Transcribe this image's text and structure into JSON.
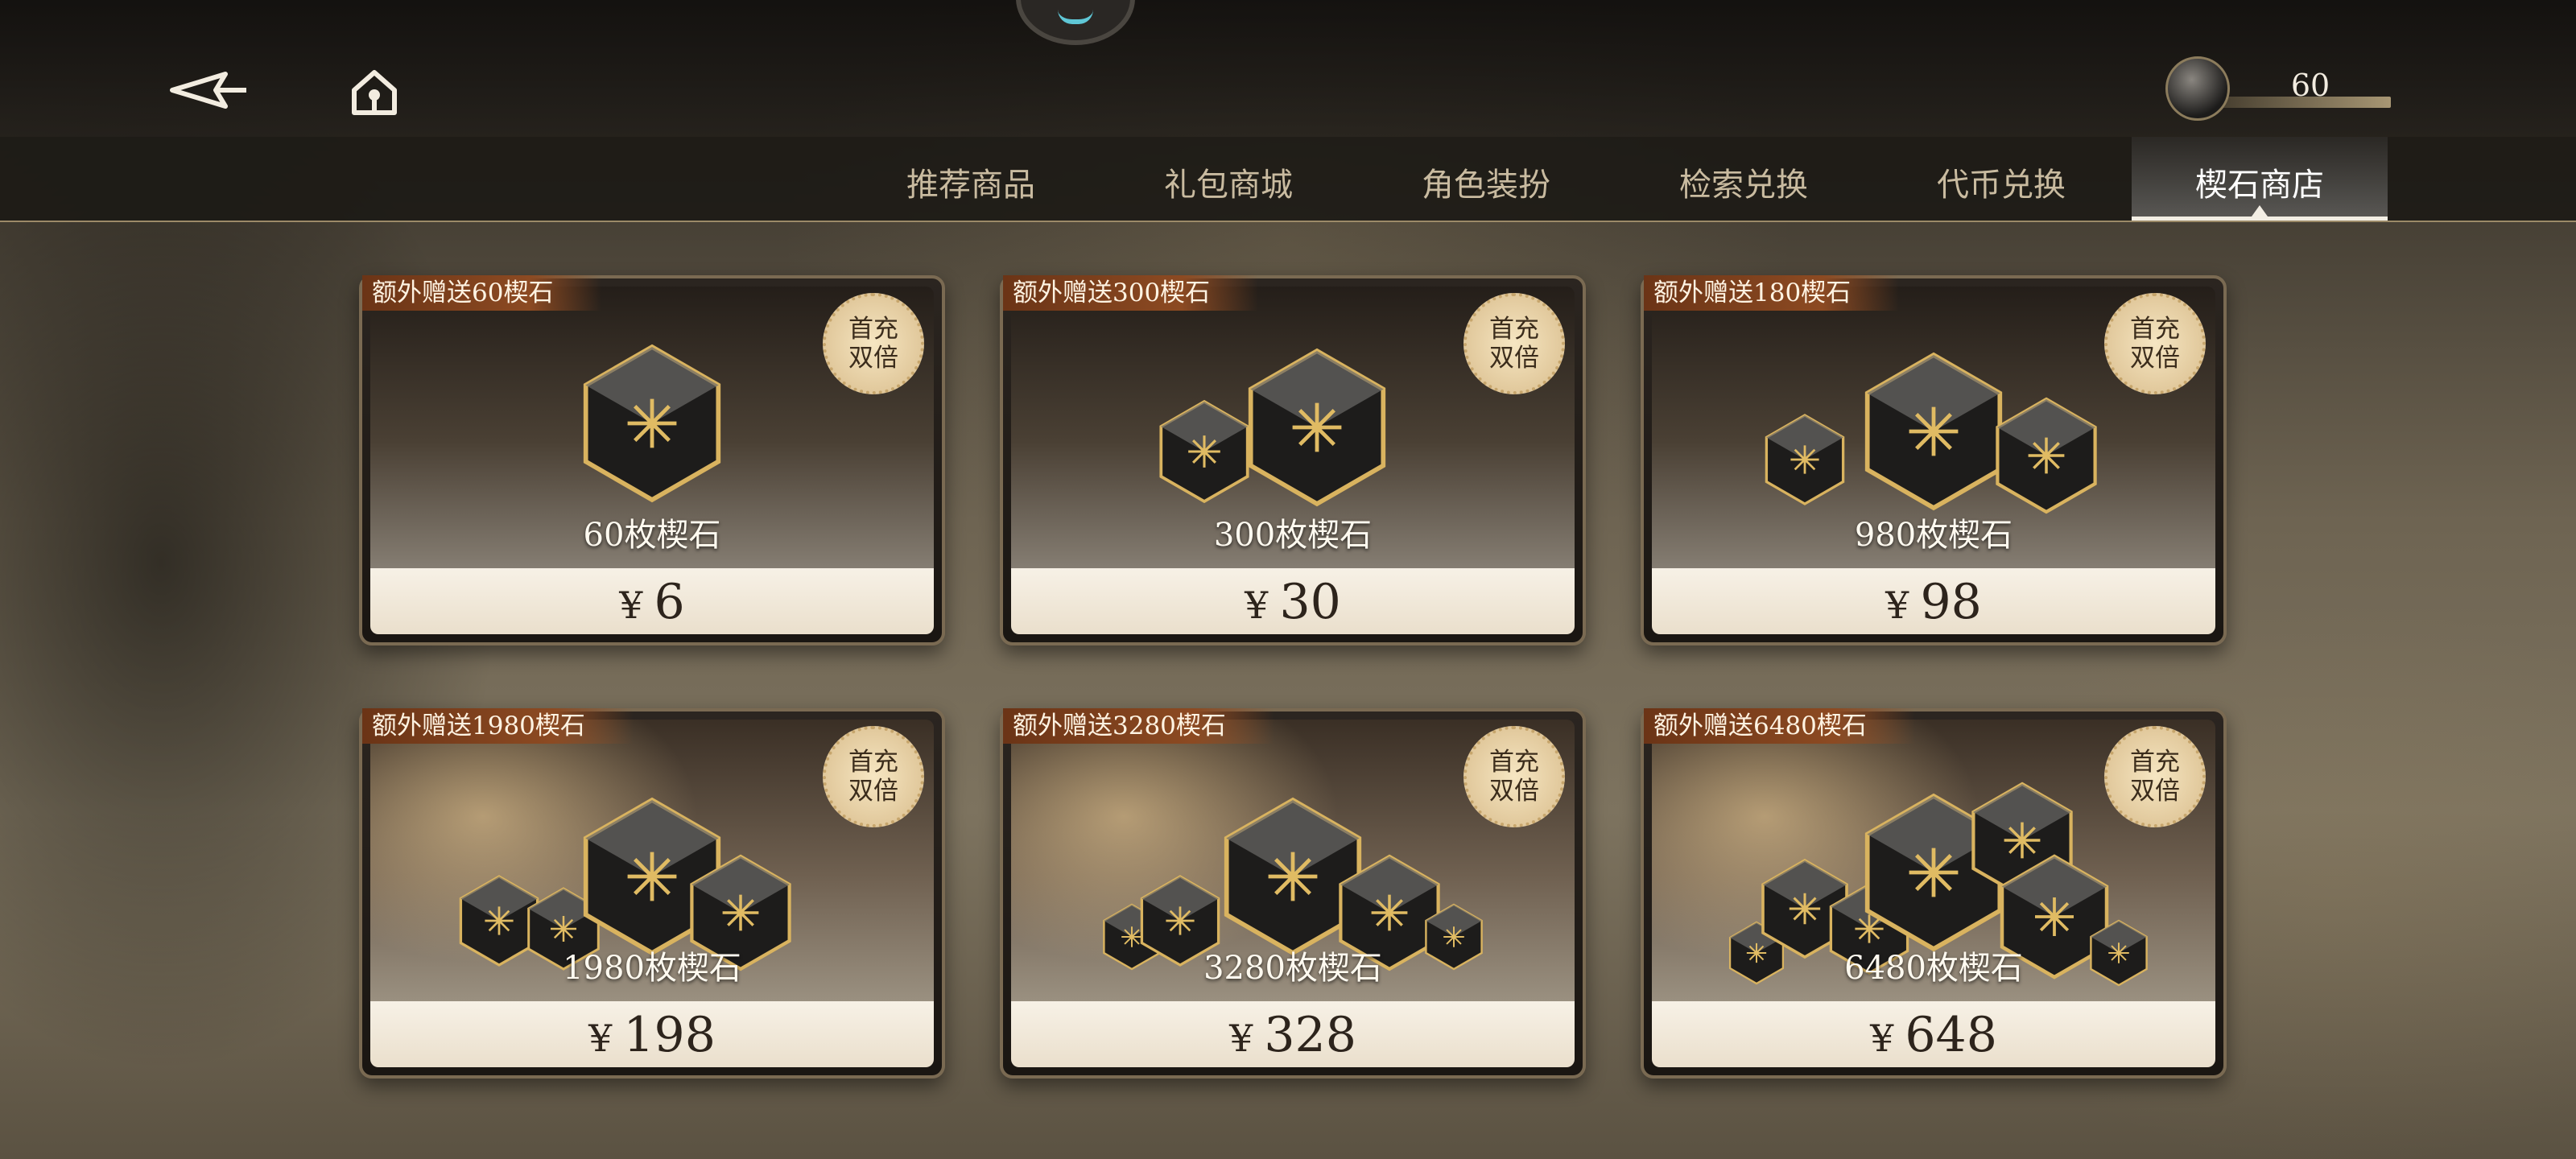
{
  "header": {
    "currency_count": "60",
    "icons": {
      "back": "back-arrow-icon",
      "home": "home-icon",
      "currency": "gem-currency-icon"
    }
  },
  "tabs": [
    {
      "label": "推荐商品",
      "active": false
    },
    {
      "label": "礼包商城",
      "active": false
    },
    {
      "label": "角色装扮",
      "active": false
    },
    {
      "label": "检索兑换",
      "active": false
    },
    {
      "label": "代币兑换",
      "active": false
    },
    {
      "label": "楔石商店",
      "active": true
    }
  ],
  "products": [
    {
      "bonus": "额外赠送60楔石",
      "badge_line1": "首充",
      "badge_line2": "双倍",
      "name": "60枚楔石",
      "currency_symbol": "¥",
      "price": "6",
      "gems": 1
    },
    {
      "bonus": "额外赠送300楔石",
      "badge_line1": "首充",
      "badge_line2": "双倍",
      "name": "300枚楔石",
      "currency_symbol": "¥",
      "price": "30",
      "gems": 2
    },
    {
      "bonus": "额外赠送180楔石",
      "badge_line1": "首充",
      "badge_line2": "双倍",
      "name": "980枚楔石",
      "currency_symbol": "¥",
      "price": "98",
      "gems": 3
    },
    {
      "bonus": "额外赠送1980楔石",
      "badge_line1": "首充",
      "badge_line2": "双倍",
      "name": "1980枚楔石",
      "currency_symbol": "¥",
      "price": "198",
      "gems": 4
    },
    {
      "bonus": "额外赠送3280楔石",
      "badge_line1": "首充",
      "badge_line2": "双倍",
      "name": "3280枚楔石",
      "currency_symbol": "¥",
      "price": "328",
      "gems": 5
    },
    {
      "bonus": "额外赠送6480楔石",
      "badge_line1": "首充",
      "badge_line2": "双倍",
      "name": "6480枚楔石",
      "currency_symbol": "¥",
      "price": "648",
      "gems": 7
    }
  ],
  "colors": {
    "accent_gold": "#c6a56c",
    "bonus_ribbon": "#8c4a22",
    "price_bg": "#f7f1e6"
  }
}
